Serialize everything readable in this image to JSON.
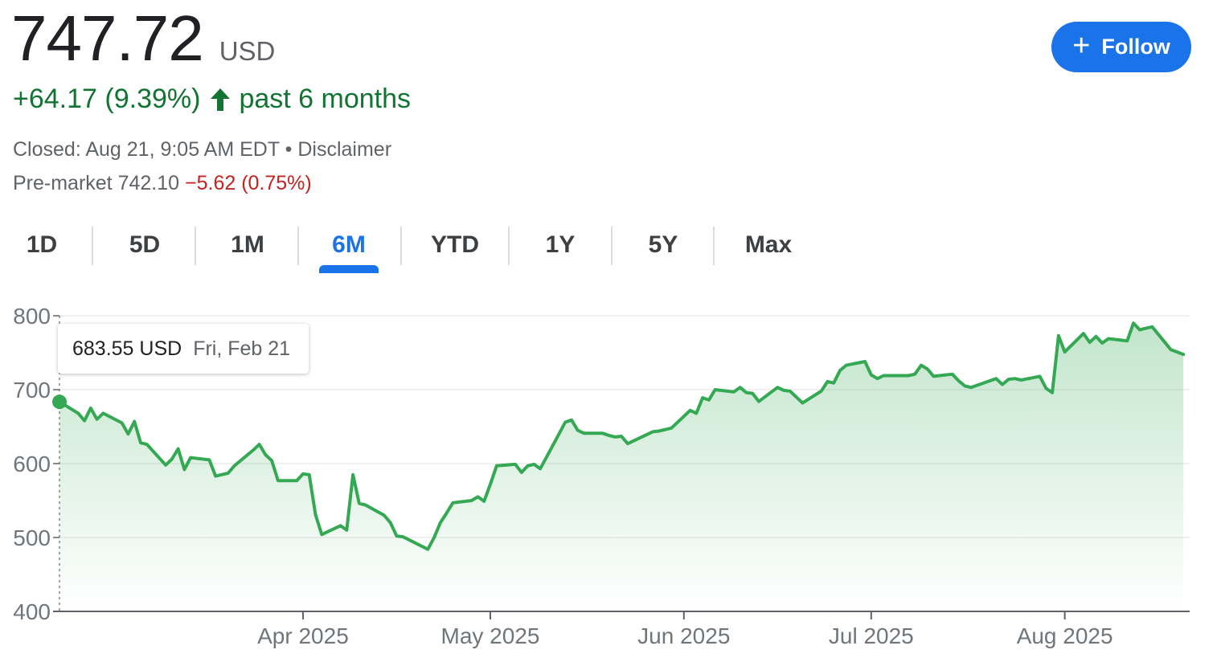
{
  "quote": {
    "price": "747.72",
    "currency": "USD",
    "change": "+64.17 (9.39%)",
    "period": "past 6 months",
    "closed_text": "Closed: Aug 21, 9:05 AM EDT",
    "bullet": "•",
    "disclaimer": "Disclaimer",
    "premarket_label": "Pre-market 742.10",
    "premarket_change": "−5.62 (0.75%)"
  },
  "follow": {
    "label": "Follow"
  },
  "tabs": [
    {
      "label": "1D"
    },
    {
      "label": "5D"
    },
    {
      "label": "1M"
    },
    {
      "label": "6M",
      "active": true
    },
    {
      "label": "YTD"
    },
    {
      "label": "1Y"
    },
    {
      "label": "5Y"
    },
    {
      "label": "Max"
    }
  ],
  "tooltip": {
    "value": "683.55 USD",
    "date": "Fri, Feb 21"
  },
  "colors": {
    "line": "#34a853",
    "accent": "#1a73e8",
    "positive": "#137333",
    "negative": "#c5221f"
  },
  "chart_data": {
    "type": "area",
    "ylim": [
      400,
      800
    ],
    "yticks": [
      400,
      500,
      600,
      700,
      800
    ],
    "x_range": [
      "2025-02-21",
      "2025-08-21"
    ],
    "xticks": [
      {
        "date": "2025-04-01",
        "label": "Apr 2025"
      },
      {
        "date": "2025-05-01",
        "label": "May 2025"
      },
      {
        "date": "2025-06-01",
        "label": "Jun 2025"
      },
      {
        "date": "2025-07-01",
        "label": "Jul 2025"
      },
      {
        "date": "2025-08-01",
        "label": "Aug 2025"
      }
    ],
    "grid": true,
    "series": [
      {
        "values": [
          [
            "2025-02-21",
            683.55
          ],
          [
            "2025-02-24",
            668
          ],
          [
            "2025-02-25",
            658
          ],
          [
            "2025-02-26",
            675
          ],
          [
            "2025-02-27",
            660
          ],
          [
            "2025-02-28",
            668
          ],
          [
            "2025-03-03",
            655
          ],
          [
            "2025-03-04",
            640
          ],
          [
            "2025-03-05",
            657
          ],
          [
            "2025-03-06",
            628
          ],
          [
            "2025-03-07",
            626
          ],
          [
            "2025-03-10",
            598
          ],
          [
            "2025-03-11",
            606
          ],
          [
            "2025-03-12",
            620
          ],
          [
            "2025-03-13",
            592
          ],
          [
            "2025-03-14",
            608
          ],
          [
            "2025-03-17",
            605
          ],
          [
            "2025-03-18",
            583
          ],
          [
            "2025-03-19",
            585
          ],
          [
            "2025-03-20",
            587
          ],
          [
            "2025-03-21",
            597
          ],
          [
            "2025-03-24",
            618
          ],
          [
            "2025-03-25",
            626
          ],
          [
            "2025-03-26",
            612
          ],
          [
            "2025-03-27",
            604
          ],
          [
            "2025-03-28",
            577
          ],
          [
            "2025-03-31",
            577
          ],
          [
            "2025-04-01",
            586
          ],
          [
            "2025-04-02",
            585
          ],
          [
            "2025-04-03",
            531
          ],
          [
            "2025-04-04",
            504
          ],
          [
            "2025-04-07",
            516
          ],
          [
            "2025-04-08",
            510
          ],
          [
            "2025-04-09",
            585
          ],
          [
            "2025-04-10",
            546
          ],
          [
            "2025-04-11",
            544
          ],
          [
            "2025-04-14",
            530
          ],
          [
            "2025-04-15",
            520
          ],
          [
            "2025-04-16",
            502
          ],
          [
            "2025-04-17",
            501
          ],
          [
            "2025-04-21",
            484
          ],
          [
            "2025-04-22",
            500
          ],
          [
            "2025-04-23",
            520
          ],
          [
            "2025-04-24",
            533
          ],
          [
            "2025-04-25",
            547
          ],
          [
            "2025-04-28",
            550
          ],
          [
            "2025-04-29",
            555
          ],
          [
            "2025-04-30",
            549
          ],
          [
            "2025-05-01",
            572
          ],
          [
            "2025-05-02",
            597
          ],
          [
            "2025-05-05",
            599
          ],
          [
            "2025-05-06",
            588
          ],
          [
            "2025-05-07",
            597
          ],
          [
            "2025-05-08",
            599
          ],
          [
            "2025-05-09",
            593
          ],
          [
            "2025-05-12",
            640
          ],
          [
            "2025-05-13",
            656
          ],
          [
            "2025-05-14",
            659
          ],
          [
            "2025-05-15",
            645
          ],
          [
            "2025-05-16",
            641
          ],
          [
            "2025-05-19",
            641
          ],
          [
            "2025-05-20",
            638
          ],
          [
            "2025-05-21",
            636
          ],
          [
            "2025-05-22",
            637
          ],
          [
            "2025-05-23",
            627
          ],
          [
            "2025-05-27",
            643
          ],
          [
            "2025-05-28",
            644
          ],
          [
            "2025-05-29",
            646
          ],
          [
            "2025-05-30",
            648
          ],
          [
            "2025-06-02",
            672
          ],
          [
            "2025-06-03",
            668
          ],
          [
            "2025-06-04",
            689
          ],
          [
            "2025-06-05",
            686
          ],
          [
            "2025-06-06",
            700
          ],
          [
            "2025-06-09",
            697
          ],
          [
            "2025-06-10",
            703
          ],
          [
            "2025-06-11",
            696
          ],
          [
            "2025-06-12",
            695
          ],
          [
            "2025-06-13",
            684
          ],
          [
            "2025-06-16",
            703
          ],
          [
            "2025-06-17",
            699
          ],
          [
            "2025-06-18",
            698
          ],
          [
            "2025-06-20",
            682
          ],
          [
            "2025-06-23",
            698
          ],
          [
            "2025-06-24",
            711
          ],
          [
            "2025-06-25",
            709
          ],
          [
            "2025-06-26",
            726
          ],
          [
            "2025-06-27",
            733
          ],
          [
            "2025-06-30",
            738
          ],
          [
            "2025-07-01",
            720
          ],
          [
            "2025-07-02",
            715
          ],
          [
            "2025-07-03",
            719
          ],
          [
            "2025-07-07",
            719
          ],
          [
            "2025-07-08",
            721
          ],
          [
            "2025-07-09",
            733
          ],
          [
            "2025-07-10",
            728
          ],
          [
            "2025-07-11",
            718
          ],
          [
            "2025-07-14",
            721
          ],
          [
            "2025-07-15",
            712
          ],
          [
            "2025-07-16",
            705
          ],
          [
            "2025-07-17",
            703
          ],
          [
            "2025-07-18",
            706
          ],
          [
            "2025-07-21",
            715
          ],
          [
            "2025-07-22",
            707
          ],
          [
            "2025-07-23",
            714
          ],
          [
            "2025-07-24",
            715
          ],
          [
            "2025-07-25",
            713
          ],
          [
            "2025-07-28",
            718
          ],
          [
            "2025-07-29",
            702
          ],
          [
            "2025-07-30",
            696
          ],
          [
            "2025-07-31",
            773
          ],
          [
            "2025-08-01",
            751
          ],
          [
            "2025-08-04",
            776
          ],
          [
            "2025-08-05",
            764
          ],
          [
            "2025-08-06",
            772
          ],
          [
            "2025-08-07",
            763
          ],
          [
            "2025-08-08",
            769
          ],
          [
            "2025-08-11",
            766
          ],
          [
            "2025-08-12",
            790
          ],
          [
            "2025-08-13",
            781
          ],
          [
            "2025-08-14",
            783
          ],
          [
            "2025-08-15",
            785
          ],
          [
            "2025-08-18",
            754
          ],
          [
            "2025-08-19",
            751
          ],
          [
            "2025-08-20",
            747.72
          ]
        ]
      }
    ]
  }
}
